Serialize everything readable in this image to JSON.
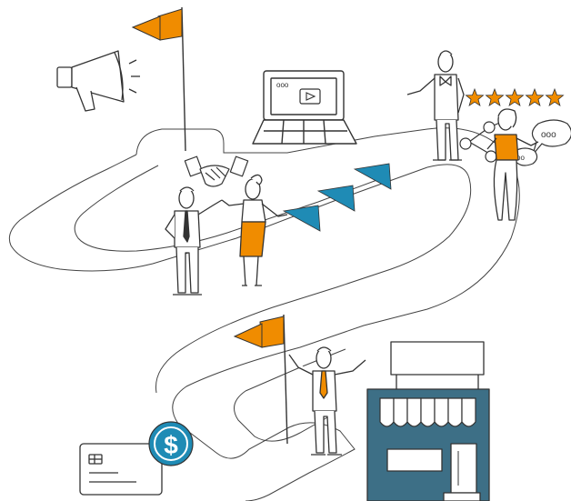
{
  "illustration": {
    "card_dollar_sign": "$",
    "chat_bubble_text": "ooo",
    "chat_bubble_small_text": "oo",
    "laptop_window_dots": "ooo",
    "rating_stars": 5,
    "road_pennants": 3
  },
  "colors": {
    "orange": "#f08c00",
    "teal": "#1f8bb5",
    "store_blue": "#3d6f86",
    "stroke": "#333333",
    "road_stroke": "#444444"
  },
  "icons": [
    "megaphone-icon",
    "flag-icon",
    "laptop-icon",
    "play-icon",
    "star-icon",
    "chat-bubble-icon",
    "handshake-icon",
    "credit-card-icon",
    "dollar-coin-icon",
    "storefront-icon"
  ]
}
